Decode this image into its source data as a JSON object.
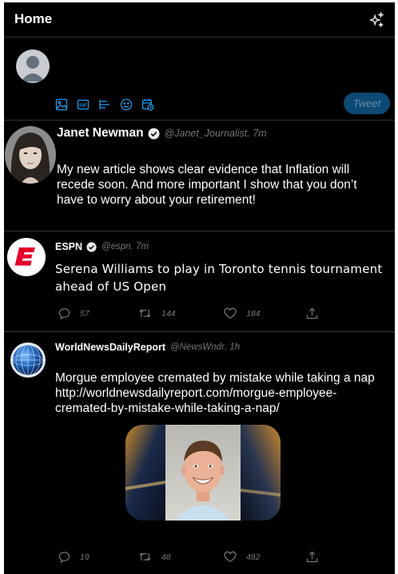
{
  "header": {
    "title": "Home",
    "sparkle_icon": "sparkle-icon"
  },
  "composer": {
    "tools": [
      "image-icon",
      "gif-icon",
      "poll-icon",
      "emoji-icon",
      "schedule-icon"
    ],
    "gif_label": "GIF",
    "tweet_label": "Tweet"
  },
  "tweets": [
    {
      "name": "Janet Newman",
      "handle": "@Janet_Journalist",
      "time": " . 7m",
      "text": "My new article shows clear evidence that Inflation will recede soon. And more important I show that you don’t have to worry about your retirement!"
    },
    {
      "name": "ESPN",
      "handle": "@espn",
      "time": " . 7m",
      "text": "Serena Williams to play in Toronto tennis tournament ahead of US Open",
      "replies": "57",
      "retweets": "144",
      "likes": "184"
    },
    {
      "name": "WorldNewsDailyReport",
      "handle": "@NewsWndr",
      "time": " . 1h",
      "text": "Morgue employee cremated by mistake while taking a nap http://worldnewsdailyreport.com/morgue-employee-cremated-by-mistake-while-taking-a-nap/",
      "replies": "19",
      "retweets": "48",
      "likes": "482"
    }
  ],
  "colors": {
    "background": "#000000",
    "accent": "#1d9bf0",
    "tweet_button": "#0d4a75",
    "muted": "#71767b",
    "espn_red": "#e4002b"
  }
}
